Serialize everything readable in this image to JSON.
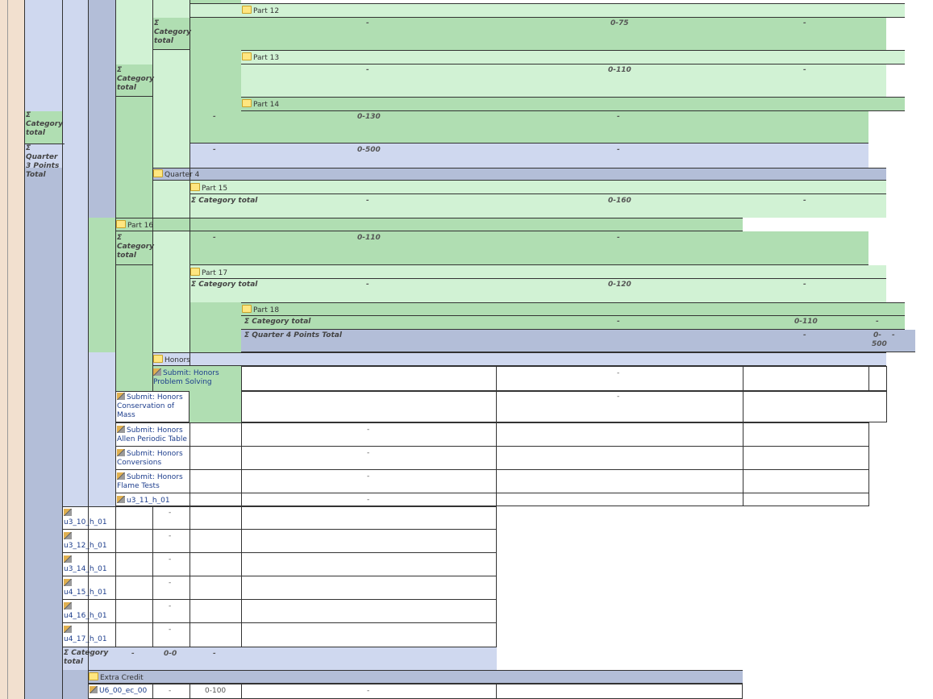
{
  "colors": {
    "peach": "#f2e0cf",
    "lavender": "#cfd8ef",
    "slate": "#b3bed8",
    "green_mid": "#b0deb2",
    "green_light": "#d1f2d4",
    "green_dark": "#8ed095",
    "white": "#ffffff"
  },
  "labels": {
    "category_total": "Σ Category total",
    "q3_points_total": "Σ Quarter 3 Points Total",
    "q4_points_total": "Σ Quarter 4 Points Total",
    "quarter4": "Quarter 4",
    "part12": "Part 12",
    "part13": "Part 13",
    "part14": "Part 14",
    "part15": "Part 15",
    "part16": "Part 16",
    "part17": "Part 17",
    "part18": "Part 18",
    "honors": "Honors",
    "extra_credit": "Extra Credit"
  },
  "values": {
    "dash": "-",
    "r_0_75": "0-75",
    "r_0_110": "0-110",
    "r_0_130": "0-130",
    "r_0_500": "0-500",
    "r_0_160": "0-160",
    "r_0_120": "0-120",
    "r_0_0": "0-0",
    "r_0_100": "0-100",
    "r_0_dash": "0-",
    "n_500": "500"
  },
  "items": {
    "honors_problem_solving": "Submit: Honors Problem Solving",
    "honors_conservation": "Submit: Honors Conservation of Mass",
    "honors_allen": "Submit: Honors Allen Periodic Table",
    "honors_conversions": "Submit: Honors Conversions",
    "honors_flame": "Submit: Honors Flame Tests",
    "u3_11": "u3_11_h_01",
    "u3_10": "u3_10_h_01",
    "u3_12": "u3_12_h_01",
    "u3_14": "u3_14_h_01",
    "u4_15": "u4_15_h_01",
    "u4_16": "u4_16_h_01",
    "u4_17": "u4_17_h_01",
    "u6_00_ec": "U6_00_ec_00"
  }
}
